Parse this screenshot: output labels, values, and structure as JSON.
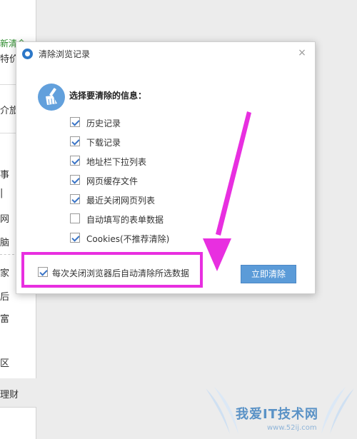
{
  "background": {
    "fragments": [
      "新清令",
      "特价",
      "介旅",
      "事",
      "|",
      "网",
      "脑",
      "家",
      "后",
      "富",
      "区",
      "理财"
    ]
  },
  "dialog": {
    "title": "清除浏览记录",
    "close_glyph": "×",
    "heading": "选择要清除的信息：",
    "options": [
      {
        "label": "历史记录",
        "checked": true
      },
      {
        "label": "下载记录",
        "checked": true
      },
      {
        "label": "地址栏下拉列表",
        "checked": true
      },
      {
        "label": "网页缓存文件",
        "checked": true
      },
      {
        "label": "最近关闭网页列表",
        "checked": true
      },
      {
        "label": "自动填写的表单数据",
        "checked": false
      },
      {
        "label": "Cookies(不推荐清除)",
        "checked": true
      }
    ],
    "auto_clear": {
      "label": "每次关闭浏览器后自动清除所选数据",
      "checked": true
    },
    "clear_button": "立即清除"
  },
  "annotation": {
    "highlight_color": "#e82fe0",
    "arrow_color": "#e82fe0"
  },
  "watermark": {
    "text": "我爱IT技术网",
    "url": "www.52ij.com"
  }
}
